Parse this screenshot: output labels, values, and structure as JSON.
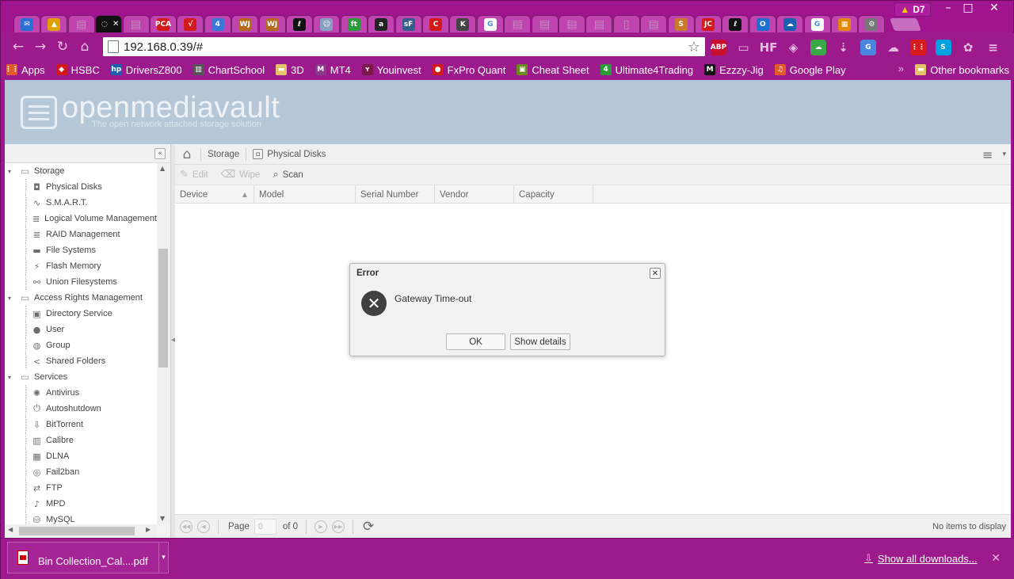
{
  "browser": {
    "profile_label": "D7",
    "tabs": [
      {
        "icon": "mail-icon",
        "glyph": "✉",
        "color": "#2b6fd6"
      },
      {
        "icon": "drive-icon",
        "glyph": "▲",
        "color": "#e0a100"
      },
      {
        "icon": "page-icon",
        "glyph": "▤",
        "color": "#c58ebf"
      },
      {
        "icon": "loading-icon",
        "glyph": "◌",
        "color": "#111",
        "active": true
      },
      {
        "icon": "page-icon",
        "glyph": "▤",
        "color": "#c58ebf"
      },
      {
        "icon": "pca-icon",
        "glyph": "PCA",
        "color": "#d21a1a"
      },
      {
        "icon": "tick-icon",
        "glyph": "√",
        "color": "#d21a1a"
      },
      {
        "icon": "calendar-icon",
        "glyph": "4",
        "color": "#3a78d8"
      },
      {
        "icon": "wj-icon",
        "glyph": "WJ",
        "color": "#b36a1a"
      },
      {
        "icon": "wj-icon",
        "glyph": "WJ",
        "color": "#b36a1a"
      },
      {
        "icon": "chart-icon",
        "glyph": "ℓ",
        "color": "#111"
      },
      {
        "icon": "person-icon",
        "glyph": "☺",
        "color": "#8aa0c0"
      },
      {
        "icon": "ft-icon",
        "glyph": "ft",
        "color": "#2a9a3a"
      },
      {
        "icon": "amazon-icon",
        "glyph": "a",
        "color": "#222"
      },
      {
        "icon": "sf-icon",
        "glyph": "sF",
        "color": "#355c8a"
      },
      {
        "icon": "c-icon",
        "glyph": "C",
        "color": "#d21a1a"
      },
      {
        "icon": "k-icon",
        "glyph": "K",
        "color": "#444"
      },
      {
        "icon": "google-icon",
        "glyph": "G",
        "color": "#fff"
      },
      {
        "icon": "page-icon",
        "glyph": "▤",
        "color": "#c58ebf"
      },
      {
        "icon": "page-icon",
        "glyph": "▤",
        "color": "#c58ebf"
      },
      {
        "icon": "page-icon",
        "glyph": "▤",
        "color": "#c58ebf"
      },
      {
        "icon": "page-icon",
        "glyph": "▤",
        "color": "#c58ebf"
      },
      {
        "icon": "doc-icon",
        "glyph": "▯",
        "color": "#c58ebf"
      },
      {
        "icon": "page-icon",
        "glyph": "▤",
        "color": "#c58ebf"
      },
      {
        "icon": "s-icon",
        "glyph": "S",
        "color": "#c87a2a"
      },
      {
        "icon": "jc-icon",
        "glyph": "JC",
        "color": "#d21a1a"
      },
      {
        "icon": "chart-icon",
        "glyph": "ℓ",
        "color": "#111"
      },
      {
        "icon": "outlook-icon",
        "glyph": "O",
        "color": "#1a6fd0"
      },
      {
        "icon": "onedrive-icon",
        "glyph": "☁",
        "color": "#1a5fb0"
      },
      {
        "icon": "google-icon",
        "glyph": "G",
        "color": "#fff"
      },
      {
        "icon": "shop-icon",
        "glyph": "▦",
        "color": "#e08a00"
      },
      {
        "icon": "settings-icon",
        "glyph": "⚙",
        "color": "#777"
      }
    ],
    "address": "192.168.0.39/#",
    "extensions": [
      {
        "icon": "adblock-icon",
        "glyph": "ABP",
        "color": "#c8102e"
      },
      {
        "icon": "cast-icon",
        "glyph": "▭",
        "color": "#b07aaa"
      },
      {
        "icon": "hf-icon",
        "glyph": "HF",
        "color": "#9d1a8d"
      },
      {
        "icon": "shield-icon",
        "glyph": "◈",
        "color": "#9d1a8d"
      },
      {
        "icon": "evernote-icon",
        "glyph": "☁",
        "color": "#3aa845"
      },
      {
        "icon": "download-icon",
        "glyph": "⇣",
        "color": "#9d1a8d"
      },
      {
        "icon": "translate-icon",
        "glyph": "G",
        "color": "#4a85e0"
      },
      {
        "icon": "cloud-icon",
        "glyph": "☁",
        "color": "#9d1a8d"
      },
      {
        "icon": "apps-grid-icon",
        "glyph": "⋮⋮",
        "color": "#d81a1a"
      },
      {
        "icon": "skype-icon",
        "glyph": "S",
        "color": "#00a2e0"
      },
      {
        "icon": "pawprint-icon",
        "glyph": "✿",
        "color": "#9d1a8d"
      },
      {
        "icon": "chrome-menu-icon",
        "glyph": "≡",
        "color": "#9d1a8d"
      }
    ]
  },
  "bookmarks": {
    "items": [
      {
        "label": "Apps",
        "icon": "apps-icon",
        "glyph": "⋮⋮",
        "color": "#e35b2a"
      },
      {
        "label": "HSBC",
        "icon": "hsbc-icon",
        "glyph": "◆",
        "color": "#d21a1a"
      },
      {
        "label": "DriversZ800",
        "icon": "hp-icon",
        "glyph": "hp",
        "color": "#1a5fb0"
      },
      {
        "label": "ChartSchool",
        "icon": "chartschool-icon",
        "glyph": "▥",
        "color": "#555"
      },
      {
        "label": "3D",
        "icon": "folder-icon",
        "glyph": "▬",
        "color": "#e6c36a"
      },
      {
        "label": "MT4",
        "icon": "mt4-icon",
        "glyph": "M",
        "color": "#8a3a8a"
      },
      {
        "label": "Youinvest",
        "icon": "youinvest-icon",
        "glyph": "ʏ",
        "color": "#7a1a4a"
      },
      {
        "label": "FxPro Quant",
        "icon": "fxpro-icon",
        "glyph": "●",
        "color": "#d21a1a"
      },
      {
        "label": "Cheat Sheet",
        "icon": "cheatsheet-icon",
        "glyph": "▣",
        "color": "#6a8a1a"
      },
      {
        "label": "Ultimate4Trading",
        "icon": "u4t-icon",
        "glyph": "4",
        "color": "#2a9a3a"
      },
      {
        "label": "Ezzzy-Jig",
        "icon": "ezzzy-icon",
        "glyph": "M",
        "color": "#111"
      },
      {
        "label": "Google Play",
        "icon": "headphones-icon",
        "glyph": "♫",
        "color": "#e35b2a"
      }
    ],
    "other_label": "Other bookmarks"
  },
  "omv": {
    "logo_text": "openmediavault",
    "tagline": "The open network attached storage solution"
  },
  "nav": {
    "rows": [
      {
        "type": "group",
        "label": "Storage",
        "icon": "folder-open-icon",
        "glyph": "▭"
      },
      {
        "type": "leaf",
        "label": "Physical Disks",
        "icon": "disk-icon",
        "glyph": "◘"
      },
      {
        "type": "leaf",
        "label": "S.M.A.R.T.",
        "icon": "smart-icon",
        "glyph": "∿"
      },
      {
        "type": "leaf",
        "label": "Logical Volume Management",
        "icon": "lvm-icon",
        "glyph": "≣"
      },
      {
        "type": "leaf",
        "label": "RAID Management",
        "icon": "raid-icon",
        "glyph": "≣"
      },
      {
        "type": "leaf",
        "label": "File Systems",
        "icon": "folder-icon",
        "glyph": "▬"
      },
      {
        "type": "leaf",
        "label": "Flash Memory",
        "icon": "flash-icon",
        "glyph": "⚡"
      },
      {
        "type": "leaf",
        "label": "Union Filesystems",
        "icon": "union-icon",
        "glyph": "⚯"
      },
      {
        "type": "group",
        "label": "Access Rights Management",
        "icon": "folder-open-icon",
        "glyph": "▭"
      },
      {
        "type": "leaf",
        "label": "Directory Service",
        "icon": "directory-icon",
        "glyph": "▣"
      },
      {
        "type": "leaf",
        "label": "User",
        "icon": "user-icon",
        "glyph": "●"
      },
      {
        "type": "leaf",
        "label": "Group",
        "icon": "group-icon",
        "glyph": "◍"
      },
      {
        "type": "leaf",
        "label": "Shared Folders",
        "icon": "share-icon",
        "glyph": "<"
      },
      {
        "type": "group",
        "label": "Services",
        "icon": "folder-open-icon",
        "glyph": "▭"
      },
      {
        "type": "leaf",
        "label": "Antivirus",
        "icon": "antivirus-icon",
        "glyph": "✺"
      },
      {
        "type": "leaf",
        "label": "Autoshutdown",
        "icon": "power-icon",
        "glyph": "⏻"
      },
      {
        "type": "leaf",
        "label": "BitTorrent",
        "icon": "bittorrent-icon",
        "glyph": "⇩"
      },
      {
        "type": "leaf",
        "label": "Calibre",
        "icon": "calibre-icon",
        "glyph": "▥"
      },
      {
        "type": "leaf",
        "label": "DLNA",
        "icon": "dlna-icon",
        "glyph": "▦"
      },
      {
        "type": "leaf",
        "label": "Fail2ban",
        "icon": "fail2ban-icon",
        "glyph": "◎"
      },
      {
        "type": "leaf",
        "label": "FTP",
        "icon": "ftp-icon",
        "glyph": "⇄"
      },
      {
        "type": "leaf",
        "label": "MPD",
        "icon": "mpd-icon",
        "glyph": "♪"
      },
      {
        "type": "leaf",
        "label": "MySQL",
        "icon": "mysql-icon",
        "glyph": "⛁"
      }
    ]
  },
  "main": {
    "breadcrumb": {
      "root": "Storage",
      "current": "Physical Disks"
    },
    "actions": [
      {
        "label": "Edit",
        "icon": "edit-icon",
        "glyph": "✎",
        "disabled": true
      },
      {
        "label": "Wipe",
        "icon": "wipe-icon",
        "glyph": "⌫",
        "disabled": true
      },
      {
        "label": "Scan",
        "icon": "search-icon",
        "glyph": "⌕",
        "disabled": false
      }
    ],
    "columns": [
      {
        "label": "Device",
        "sorted": true
      },
      {
        "label": "Model",
        "sorted": false
      },
      {
        "label": "Serial Number",
        "sorted": false
      },
      {
        "label": "Vendor",
        "sorted": false
      },
      {
        "label": "Capacity",
        "sorted": false
      }
    ],
    "pager": {
      "page_label": "Page",
      "page_value": "0",
      "of_label": "of 0",
      "status": "No items to display"
    }
  },
  "dialog": {
    "title": "Error",
    "message": "Gateway Time-out",
    "ok_label": "OK",
    "details_label": "Show details"
  },
  "downloads": {
    "file_name": "Bin Collection_Cal....pdf",
    "show_all": "Show all downloads..."
  }
}
